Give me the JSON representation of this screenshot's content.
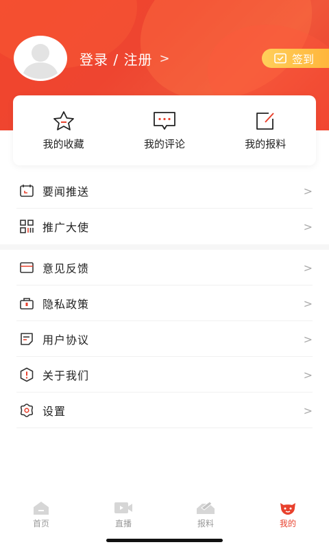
{
  "header": {
    "login_label": "登录 / 注册",
    "login_chevron": ">",
    "signin_label": "签到"
  },
  "shortcuts": [
    {
      "label": "我的收藏",
      "icon": "star-icon"
    },
    {
      "label": "我的评论",
      "icon": "comment-icon"
    },
    {
      "label": "我的报料",
      "icon": "edit-icon"
    }
  ],
  "menu": {
    "items": [
      {
        "label": "要闻推送",
        "icon": "calendar-icon"
      },
      {
        "label": "推广大使",
        "icon": "qrcode-icon"
      },
      {
        "label": "意见反馈",
        "icon": "mail-icon"
      },
      {
        "label": "隐私政策",
        "icon": "lock-icon"
      },
      {
        "label": "用户协议",
        "icon": "document-icon"
      },
      {
        "label": "关于我们",
        "icon": "info-icon"
      },
      {
        "label": "设置",
        "icon": "gear-icon"
      }
    ],
    "arrow": ">"
  },
  "tabbar": {
    "tabs": [
      {
        "label": "首页",
        "icon": "home-icon"
      },
      {
        "label": "直播",
        "icon": "video-icon"
      },
      {
        "label": "报料",
        "icon": "report-icon"
      },
      {
        "label": "我的",
        "icon": "profile-icon"
      }
    ],
    "active_index": 3
  },
  "colors": {
    "brand": "#e8412d",
    "signin": "#ffbf47",
    "muted": "#999999"
  }
}
